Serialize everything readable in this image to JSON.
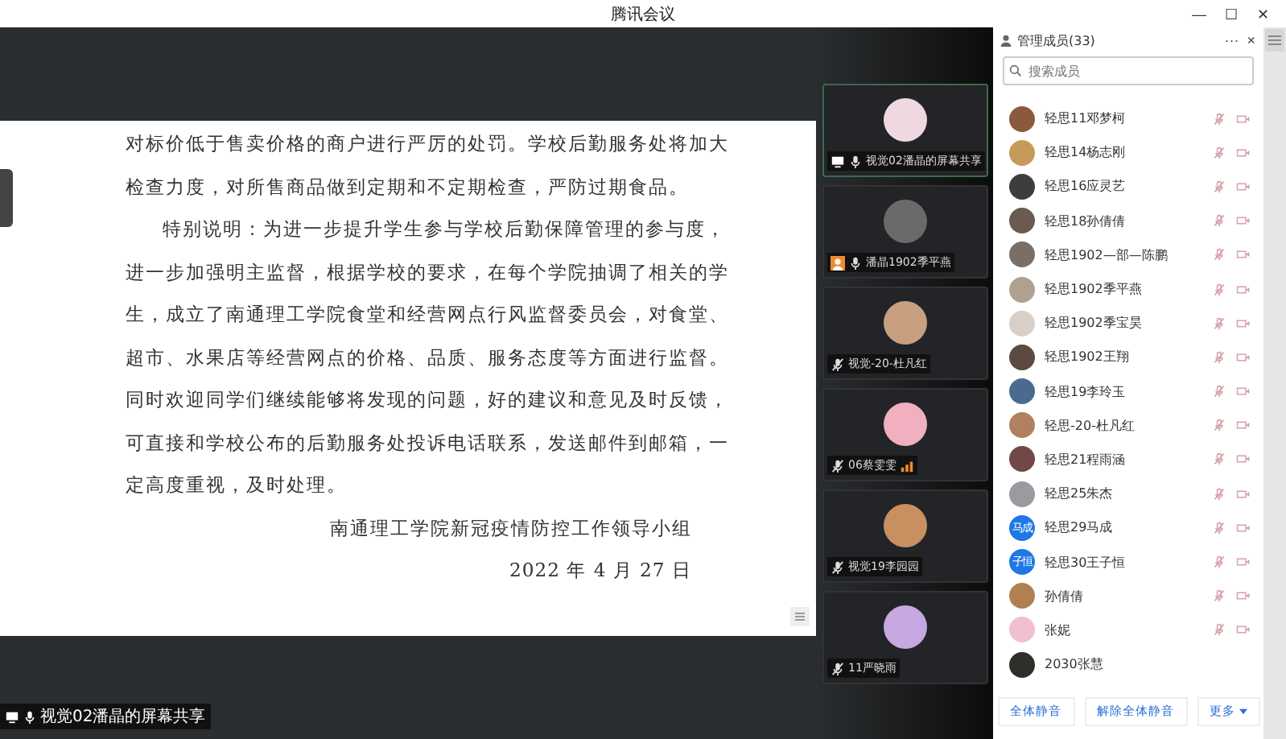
{
  "window": {
    "title": "腾讯会议",
    "controls": [
      "—",
      "☐",
      "✕"
    ]
  },
  "document": {
    "lines": [
      {
        "kind": "body",
        "text": "对标价低于售卖价格的商户进行严厉的处罚。学校后勤服务处将加大"
      },
      {
        "kind": "body",
        "text": "检查力度，对所售商品做到定期和不定期检查，严防过期食品。"
      },
      {
        "kind": "indent",
        "text": "特别说明：为进一步提升学生参与学校后勤保障管理的参与度，"
      },
      {
        "kind": "body",
        "text": "进一步加强明主监督，根据学校的要求，在每个学院抽调了相关的学"
      },
      {
        "kind": "body",
        "text": "生，成立了南通理工学院食堂和经营网点行风监督委员会，对食堂、"
      },
      {
        "kind": "body",
        "text": "超市、水果店等经营网点的价格、品质、服务态度等方面进行监督。"
      },
      {
        "kind": "body",
        "text": "同时欢迎同学们继续能够将发现的问题，好的建议和意见及时反馈，"
      },
      {
        "kind": "body",
        "text": "可直接和学校公布的后勤服务处投诉电话联系，发送邮件到邮箱，一"
      },
      {
        "kind": "body",
        "text": "定高度重视，及时处理。"
      },
      {
        "kind": "right",
        "text": "南通理工学院新冠疫情防控工作领导小组"
      },
      {
        "kind": "right",
        "text": "2022 年 4 月 27 日"
      }
    ]
  },
  "share_label": "视觉02潘晶的屏幕共享",
  "tiles": [
    {
      "name": "视觉02潘晶的屏幕共享",
      "selected": true,
      "sharing": true,
      "badge": false,
      "mic_muted": false,
      "speaking": false
    },
    {
      "name": "潘晶1902季平燕",
      "selected": false,
      "sharing": false,
      "badge": true,
      "mic_muted": false,
      "speaking": false
    },
    {
      "name": "视觉-20-杜凡红",
      "selected": false,
      "sharing": false,
      "badge": false,
      "mic_muted": true,
      "speaking": false
    },
    {
      "name": "06蔡雯雯",
      "selected": false,
      "sharing": false,
      "badge": false,
      "mic_muted": true,
      "speaking": true
    },
    {
      "name": "视觉19李园园",
      "selected": false,
      "sharing": false,
      "badge": false,
      "mic_muted": true,
      "speaking": false
    },
    {
      "name": "11严晓雨",
      "selected": false,
      "sharing": false,
      "badge": false,
      "mic_muted": true,
      "speaking": false
    }
  ],
  "members_panel": {
    "title": "管理成员(33)",
    "more": "···",
    "close": "×",
    "search": {
      "placeholder": "搜索成员"
    },
    "members": [
      {
        "name": "轻思11邓梦柯",
        "controls": true
      },
      {
        "name": "轻思14杨志刚",
        "controls": true
      },
      {
        "name": "轻思16应灵艺",
        "controls": true
      },
      {
        "name": "轻思18孙倩倩",
        "controls": true
      },
      {
        "name": "轻思1902—部—陈鹏",
        "controls": true
      },
      {
        "name": "轻思1902季平燕",
        "controls": true
      },
      {
        "name": "轻思1902季宝昊",
        "controls": true
      },
      {
        "name": "轻思1902王翔",
        "controls": true
      },
      {
        "name": "轻思19李玲玉",
        "controls": true
      },
      {
        "name": "轻思-20-杜凡红",
        "controls": true
      },
      {
        "name": "轻思21程雨涵",
        "controls": true
      },
      {
        "name": "轻思25朱杰",
        "controls": true
      },
      {
        "name": "轻思29马成",
        "controls": true,
        "initials": "马成"
      },
      {
        "name": "轻思30王子恒",
        "controls": true,
        "initials": "子恒"
      },
      {
        "name": "孙倩倩",
        "controls": true
      },
      {
        "name": "张妮",
        "controls": true
      },
      {
        "name": "2030张慧",
        "controls": false
      }
    ],
    "buttons": [
      {
        "label": "全体静音",
        "dropdown": false
      },
      {
        "label": "解除全体静音",
        "dropdown": false
      },
      {
        "label": "更多",
        "dropdown": true
      }
    ]
  }
}
